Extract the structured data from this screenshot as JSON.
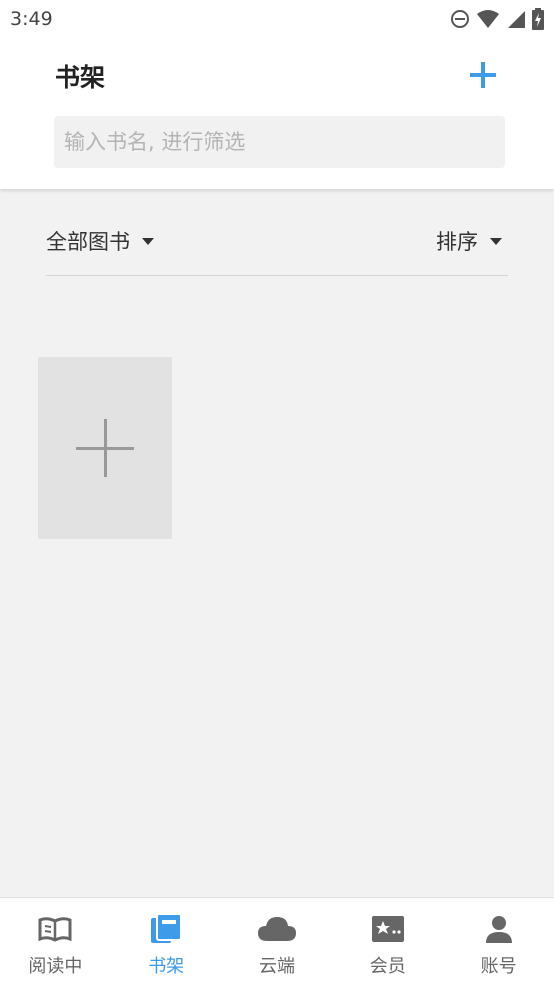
{
  "status_bar": {
    "time": "3:49"
  },
  "header": {
    "title": "书架",
    "search_placeholder": "输入书名, 进行筛选",
    "search_value": ""
  },
  "filter": {
    "category_label": "全部图书",
    "sort_label": "排序"
  },
  "bottom_nav": {
    "items": [
      {
        "label": "阅读中",
        "icon": "open-book-icon",
        "active": false
      },
      {
        "label": "书架",
        "icon": "bookshelf-icon",
        "active": true
      },
      {
        "label": "云端",
        "icon": "cloud-icon",
        "active": false
      },
      {
        "label": "会员",
        "icon": "member-card-icon",
        "active": false
      },
      {
        "label": "账号",
        "icon": "person-icon",
        "active": false
      }
    ]
  },
  "colors": {
    "accent": "#3d9be9",
    "inactive": "#666666",
    "background": "#f2f2f2",
    "tile": "#e2e2e2"
  }
}
